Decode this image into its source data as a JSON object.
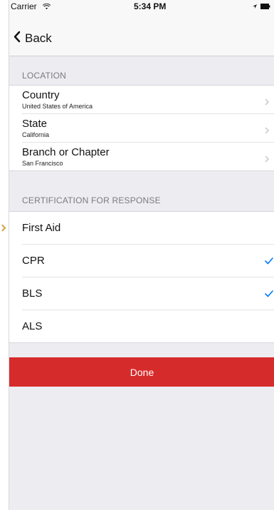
{
  "status_bar": {
    "carrier": "Carrier",
    "time": "5:34 PM"
  },
  "nav": {
    "back_label": "Back"
  },
  "location": {
    "header": "LOCATION",
    "rows": [
      {
        "title": "Country",
        "value": "United States of America"
      },
      {
        "title": "State",
        "value": "California"
      },
      {
        "title": "Branch or Chapter",
        "value": "San Francisco"
      }
    ]
  },
  "certification": {
    "header": "CERTIFICATION FOR RESPONSE",
    "options": [
      {
        "label": "First Aid",
        "checked": false
      },
      {
        "label": "CPR",
        "checked": true
      },
      {
        "label": "BLS",
        "checked": true
      },
      {
        "label": "ALS",
        "checked": false
      }
    ]
  },
  "actions": {
    "done_label": "Done"
  },
  "colors": {
    "accent": "#007aff",
    "done_button": "#d62b2b",
    "background": "#ececf1"
  },
  "icons": {
    "wifi": "wifi-icon",
    "battery": "battery-icon",
    "location": "location-arrow-icon",
    "back": "chevron-left-icon",
    "disclosure": "chevron-right-icon",
    "check": "checkmark-icon"
  }
}
